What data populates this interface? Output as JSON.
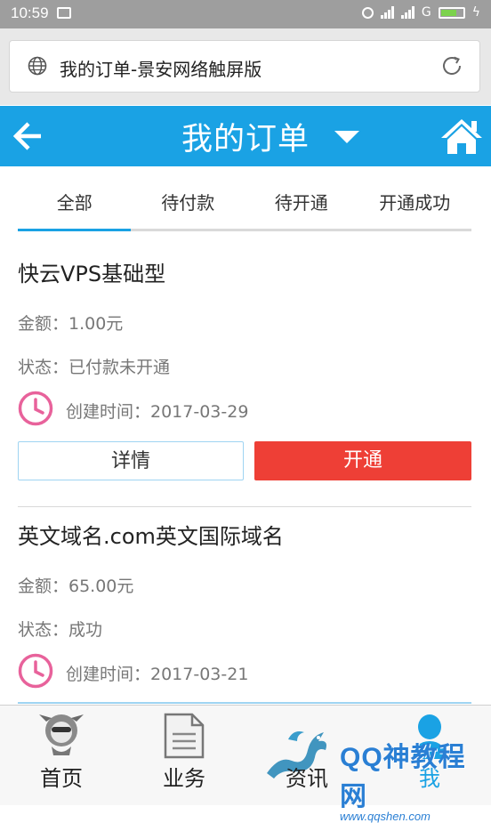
{
  "status_bar": {
    "time": "10:59",
    "network_label": "G"
  },
  "browser": {
    "page_title": "我的订单-景安网络触屏版"
  },
  "header": {
    "title": "我的订单"
  },
  "tabs": [
    {
      "label": "全部"
    },
    {
      "label": "待付款"
    },
    {
      "label": "待开通"
    },
    {
      "label": "开通成功"
    }
  ],
  "orders": [
    {
      "name": "快云VPS基础型",
      "amount": "金额：1.00元",
      "status": "状态：已付款未开通",
      "created": "创建时间：2017-03-29",
      "detail_label": "详情",
      "open_label": "开通"
    },
    {
      "name": "英文域名.com英文国际域名",
      "amount": "金额：65.00元",
      "status": "状态：成功",
      "created": "创建时间：2017-03-21"
    }
  ],
  "bottom_nav": [
    {
      "label": "首页"
    },
    {
      "label": "业务"
    },
    {
      "label": "资讯"
    },
    {
      "label": "我"
    }
  ],
  "watermark": {
    "text": "QQ神教程网",
    "url": "www.qqshen.com"
  },
  "colors": {
    "accent": "#1aa2e4",
    "danger": "#ee3f36",
    "clock": "#e8629b"
  }
}
